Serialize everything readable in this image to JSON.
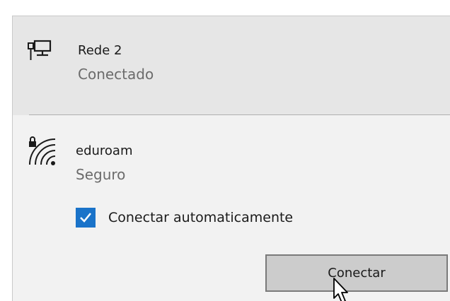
{
  "wired_network": {
    "icon": "ethernet-monitor-icon",
    "name": "Rede 2",
    "status": "Conectado"
  },
  "wifi_network": {
    "icon": "wifi-secured-icon",
    "name": "eduroam",
    "security": "Seguro",
    "auto_connect": {
      "label": "Conectar automaticamente",
      "checked": true
    },
    "connect_button": "Conectar"
  },
  "colors": {
    "accent": "#1a73c9",
    "panel_connected": "#e6e6e6",
    "panel_background": "#f2f2f2",
    "button_background": "#cccccc"
  }
}
